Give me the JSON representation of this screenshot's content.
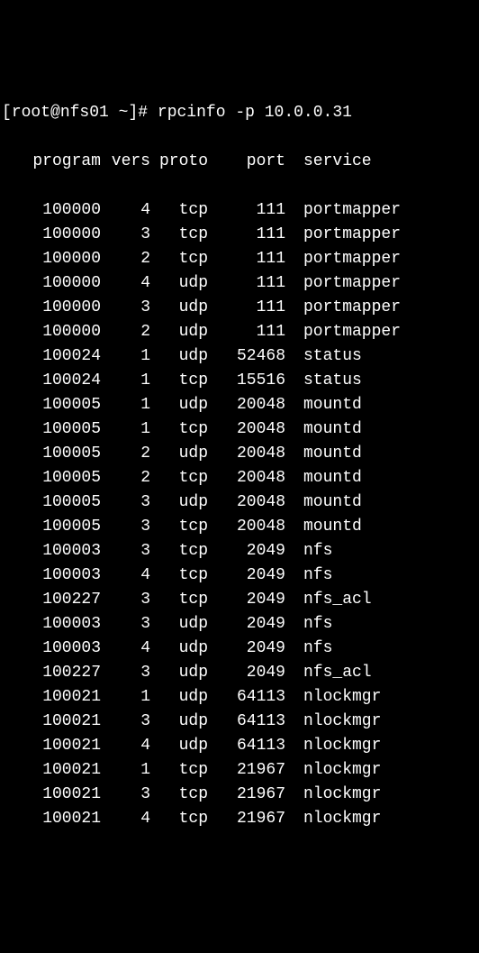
{
  "prompt": {
    "user_host": "root@nfs01",
    "cwd": "~",
    "symbol": "#",
    "command": "rpcinfo -p 10.0.0.31"
  },
  "headers": {
    "program": "program",
    "vers": "vers",
    "proto": "proto",
    "port": "port",
    "service": "service"
  },
  "rows": [
    {
      "program": "100000",
      "vers": "4",
      "proto": "tcp",
      "port": "111",
      "service": "portmapper"
    },
    {
      "program": "100000",
      "vers": "3",
      "proto": "tcp",
      "port": "111",
      "service": "portmapper"
    },
    {
      "program": "100000",
      "vers": "2",
      "proto": "tcp",
      "port": "111",
      "service": "portmapper"
    },
    {
      "program": "100000",
      "vers": "4",
      "proto": "udp",
      "port": "111",
      "service": "portmapper"
    },
    {
      "program": "100000",
      "vers": "3",
      "proto": "udp",
      "port": "111",
      "service": "portmapper"
    },
    {
      "program": "100000",
      "vers": "2",
      "proto": "udp",
      "port": "111",
      "service": "portmapper"
    },
    {
      "program": "100024",
      "vers": "1",
      "proto": "udp",
      "port": "52468",
      "service": "status"
    },
    {
      "program": "100024",
      "vers": "1",
      "proto": "tcp",
      "port": "15516",
      "service": "status"
    },
    {
      "program": "100005",
      "vers": "1",
      "proto": "udp",
      "port": "20048",
      "service": "mountd"
    },
    {
      "program": "100005",
      "vers": "1",
      "proto": "tcp",
      "port": "20048",
      "service": "mountd"
    },
    {
      "program": "100005",
      "vers": "2",
      "proto": "udp",
      "port": "20048",
      "service": "mountd"
    },
    {
      "program": "100005",
      "vers": "2",
      "proto": "tcp",
      "port": "20048",
      "service": "mountd"
    },
    {
      "program": "100005",
      "vers": "3",
      "proto": "udp",
      "port": "20048",
      "service": "mountd"
    },
    {
      "program": "100005",
      "vers": "3",
      "proto": "tcp",
      "port": "20048",
      "service": "mountd"
    },
    {
      "program": "100003",
      "vers": "3",
      "proto": "tcp",
      "port": "2049",
      "service": "nfs"
    },
    {
      "program": "100003",
      "vers": "4",
      "proto": "tcp",
      "port": "2049",
      "service": "nfs"
    },
    {
      "program": "100227",
      "vers": "3",
      "proto": "tcp",
      "port": "2049",
      "service": "nfs_acl"
    },
    {
      "program": "100003",
      "vers": "3",
      "proto": "udp",
      "port": "2049",
      "service": "nfs"
    },
    {
      "program": "100003",
      "vers": "4",
      "proto": "udp",
      "port": "2049",
      "service": "nfs"
    },
    {
      "program": "100227",
      "vers": "3",
      "proto": "udp",
      "port": "2049",
      "service": "nfs_acl"
    },
    {
      "program": "100021",
      "vers": "1",
      "proto": "udp",
      "port": "64113",
      "service": "nlockmgr"
    },
    {
      "program": "100021",
      "vers": "3",
      "proto": "udp",
      "port": "64113",
      "service": "nlockmgr"
    },
    {
      "program": "100021",
      "vers": "4",
      "proto": "udp",
      "port": "64113",
      "service": "nlockmgr"
    },
    {
      "program": "100021",
      "vers": "1",
      "proto": "tcp",
      "port": "21967",
      "service": "nlockmgr"
    },
    {
      "program": "100021",
      "vers": "3",
      "proto": "tcp",
      "port": "21967",
      "service": "nlockmgr"
    },
    {
      "program": "100021",
      "vers": "4",
      "proto": "tcp",
      "port": "21967",
      "service": "nlockmgr"
    }
  ]
}
